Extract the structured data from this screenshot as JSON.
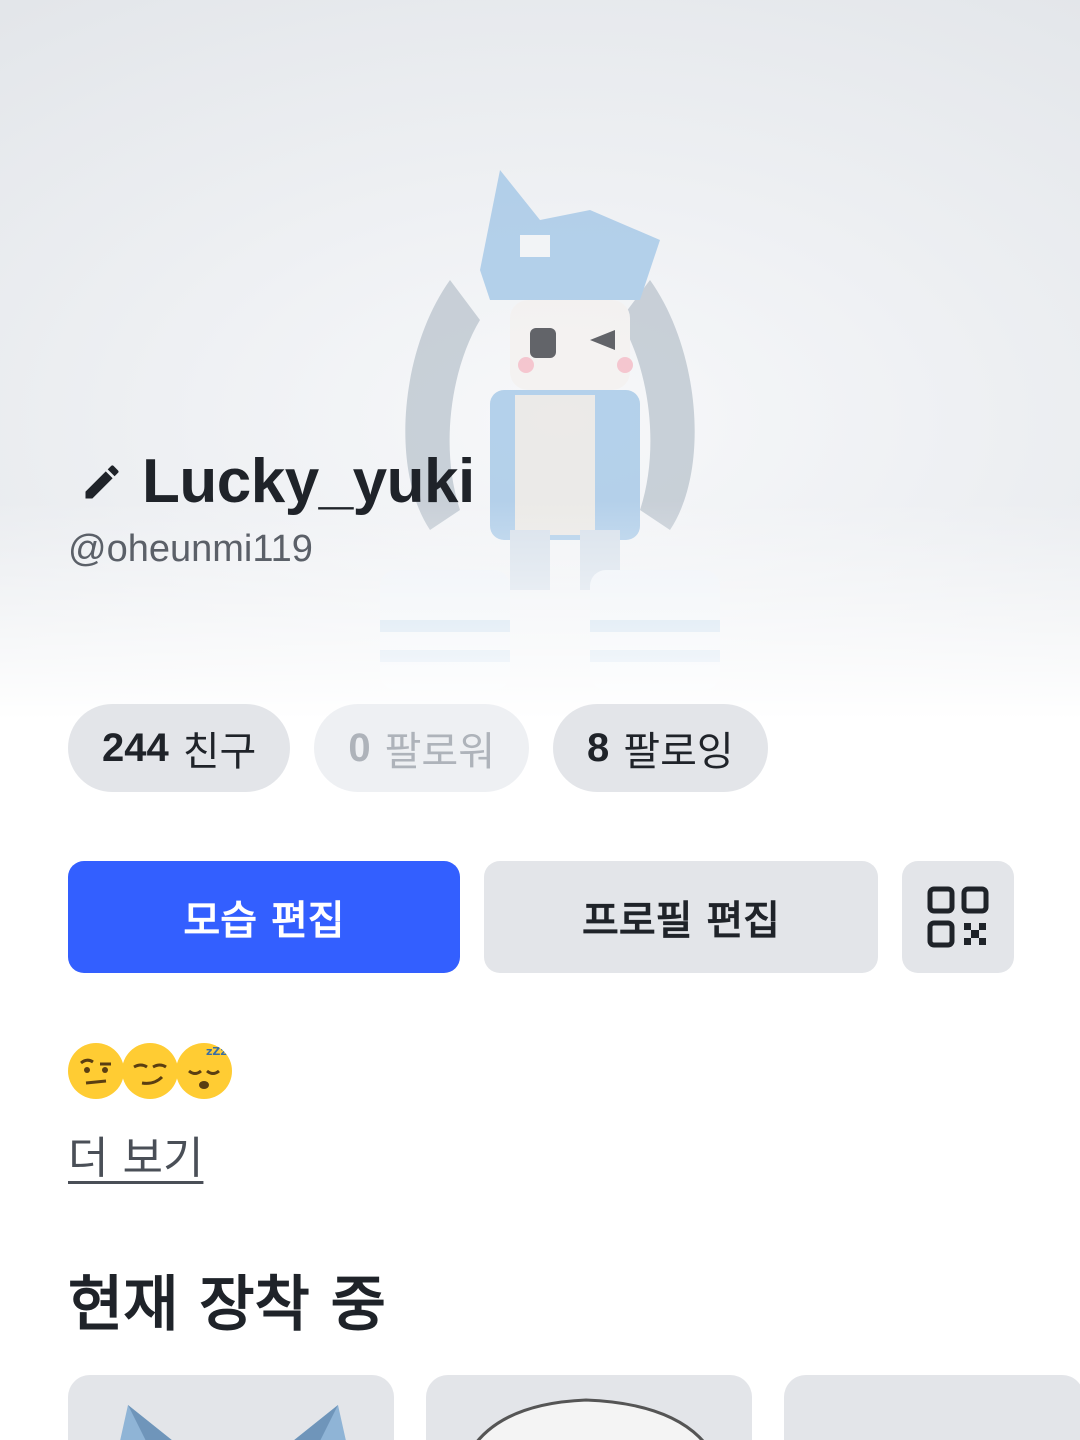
{
  "profile": {
    "display_name": "Lucky_yuki",
    "username": "@oheunmi119"
  },
  "stats": [
    {
      "count": "244",
      "label": "친구",
      "state": "active"
    },
    {
      "count": "0",
      "label": "팔로워",
      "state": "muted"
    },
    {
      "count": "8",
      "label": "팔로잉",
      "state": "active"
    }
  ],
  "actions": {
    "edit_avatar": "모습 편집",
    "edit_profile": "프로필 편집",
    "qr_icon": "qr-code-icon"
  },
  "status_emojis": [
    "face-with-raised-eyebrow",
    "smirking-face",
    "sleeping-face"
  ],
  "more_link": "더 보기",
  "currently_wearing": {
    "title": "현재 장착 중"
  },
  "colors": {
    "primary": "#335fff",
    "pill_bg": "#e3e5e9",
    "text": "#1f2329",
    "muted_text": "#aeb3ba"
  }
}
